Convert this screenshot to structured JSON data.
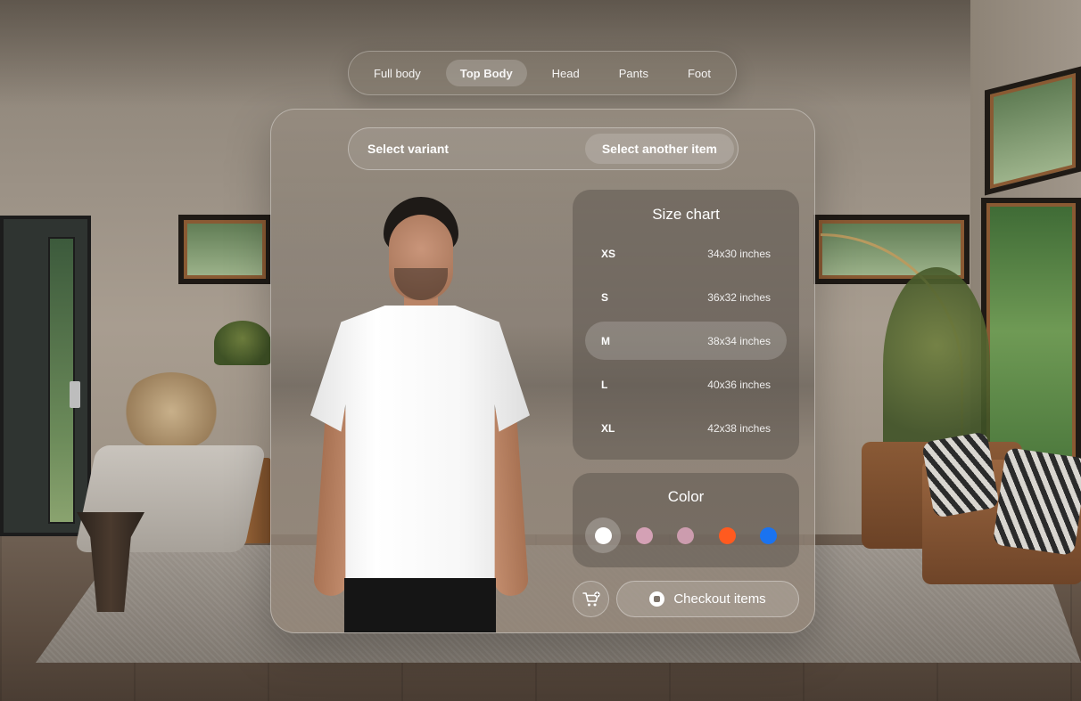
{
  "tabs": [
    {
      "label": "Full body",
      "active": false
    },
    {
      "label": "Top Body",
      "active": true
    },
    {
      "label": "Head",
      "active": false
    },
    {
      "label": "Pants",
      "active": false
    },
    {
      "label": "Foot",
      "active": false
    }
  ],
  "variant_bar": {
    "label": "Select variant",
    "another_button": "Select another item"
  },
  "size_chart": {
    "title": "Size chart",
    "selected": "M",
    "rows": [
      {
        "size": "XS",
        "measure": "34x30 inches"
      },
      {
        "size": "S",
        "measure": "36x32 inches"
      },
      {
        "size": "M",
        "measure": "38x34 inches"
      },
      {
        "size": "L",
        "measure": "40x36 inches"
      },
      {
        "size": "XL",
        "measure": "42x38 inches"
      }
    ]
  },
  "color_picker": {
    "title": "Color",
    "selected_index": 0,
    "swatches": [
      {
        "name": "white",
        "hex": "#FFFFFF"
      },
      {
        "name": "light pink",
        "hex": "#D4A1B5"
      },
      {
        "name": "dusty pink",
        "hex": "#CC9CAE"
      },
      {
        "name": "orange",
        "hex": "#FF5A1F"
      },
      {
        "name": "blue",
        "hex": "#1A73F0"
      }
    ]
  },
  "actions": {
    "cart_icon": "cart-add-icon",
    "checkout_label": "Checkout items",
    "checkout_icon": "stop-circle-icon"
  }
}
